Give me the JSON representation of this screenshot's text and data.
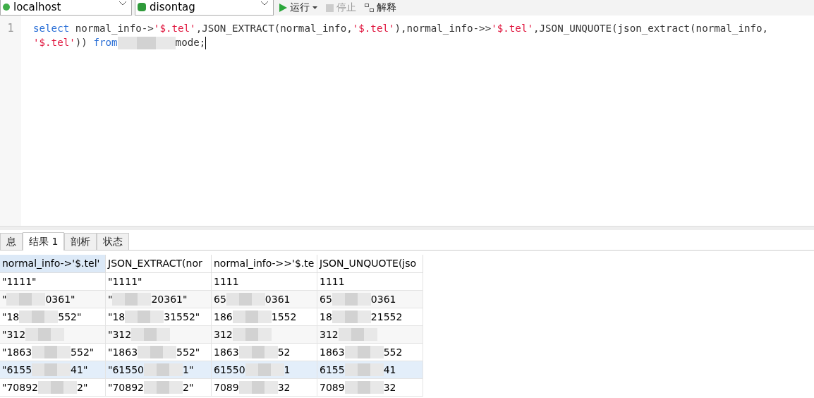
{
  "toolbar": {
    "connection": "localhost",
    "database": "disontag",
    "buttons": [
      {
        "kind": "run",
        "label": "运行",
        "disabled": false
      },
      {
        "kind": "stop",
        "label": "停止",
        "disabled": true
      },
      {
        "kind": "explain",
        "label": "解释",
        "disabled": false
      }
    ]
  },
  "editor": {
    "line_number": "1",
    "lines": [
      [
        {
          "kind": "keyword",
          "text": "select"
        },
        {
          "kind": "plain",
          "text": " normal_info->"
        },
        {
          "kind": "string",
          "text": "'$.tel'"
        },
        {
          "kind": "plain",
          "text": ",JSON_EXTRACT(normal_info,"
        },
        {
          "kind": "string",
          "text": "'$.tel'"
        },
        {
          "kind": "plain",
          "text": "),normal_info->>"
        },
        {
          "kind": "string",
          "text": "'$.tel'"
        },
        {
          "kind": "plain",
          "text": ",JSON_UNQUOTE(json_extract(normal_info,"
        }
      ],
      [
        {
          "kind": "string",
          "text": "'$.tel'"
        },
        {
          "kind": "plain",
          "text": "))"
        },
        {
          "kind": "keyword",
          "text": " from"
        },
        {
          "kind": "redacted"
        },
        {
          "kind": "plain",
          "text": "mode;"
        }
      ]
    ]
  },
  "result_tabs": [
    {
      "label": "息",
      "selected": false
    },
    {
      "label": "结果 1",
      "selected": true
    },
    {
      "label": "剖析",
      "selected": false
    },
    {
      "label": "状态",
      "selected": false
    }
  ],
  "table": {
    "columns": [
      {
        "label": "normal_info->'$.tel'",
        "selected": true
      },
      {
        "label": "JSON_EXTRACT(nor",
        "selected": false
      },
      {
        "label": "normal_info->>'$.te",
        "selected": false
      },
      {
        "label": "JSON_UNQUOTE(jso",
        "selected": false
      }
    ],
    "rows": [
      {
        "selected": false,
        "cells": [
          {
            "text": "\"1111\"",
            "redacted": false
          },
          {
            "text": "\"1111\"",
            "redacted": false
          },
          {
            "text": "1111",
            "redacted": false
          },
          {
            "text": "1111",
            "redacted": false
          }
        ]
      },
      {
        "selected": false,
        "cells": [
          {
            "text": "\"",
            "redacted": true,
            "tail": "0361\""
          },
          {
            "text": "\"",
            "redacted": true,
            "tail": "20361\""
          },
          {
            "text": "65",
            "redacted": true,
            "tail": "0361"
          },
          {
            "text": "65",
            "redacted": true,
            "tail": "0361"
          }
        ]
      },
      {
        "selected": false,
        "cells": [
          {
            "text": "\"18",
            "redacted": true,
            "tail": "552\""
          },
          {
            "text": "\"18",
            "redacted": true,
            "tail": "31552\""
          },
          {
            "text": "186",
            "redacted": true,
            "tail": "1552"
          },
          {
            "text": "18",
            "redacted": true,
            "tail": "21552"
          }
        ]
      },
      {
        "selected": false,
        "cells": [
          {
            "text": "\"312",
            "redacted": true
          },
          {
            "text": "\"312",
            "redacted": true
          },
          {
            "text": "312",
            "redacted": true
          },
          {
            "text": "312",
            "redacted": true
          }
        ]
      },
      {
        "selected": false,
        "cells": [
          {
            "text": "\"1863",
            "redacted": true,
            "tail": "552\""
          },
          {
            "text": "\"1863",
            "redacted": true,
            "tail": "552\""
          },
          {
            "text": "1863",
            "redacted": true,
            "tail": "52"
          },
          {
            "text": "1863",
            "redacted": true,
            "tail": "552"
          }
        ]
      },
      {
        "selected": true,
        "cells": [
          {
            "text": "\"6155",
            "redacted": true,
            "tail": "41\""
          },
          {
            "text": "\"61550",
            "redacted": true,
            "tail": "1\""
          },
          {
            "text": "61550",
            "redacted": true,
            "tail": "1"
          },
          {
            "text": "6155",
            "redacted": true,
            "tail": "41"
          }
        ]
      },
      {
        "selected": false,
        "cells": [
          {
            "text": "\"70892",
            "redacted": true,
            "tail": "2\""
          },
          {
            "text": "\"70892",
            "redacted": true,
            "tail": "2\""
          },
          {
            "text": "7089",
            "redacted": true,
            "tail": "32"
          },
          {
            "text": "7089",
            "redacted": true,
            "tail": "32"
          }
        ]
      }
    ]
  }
}
